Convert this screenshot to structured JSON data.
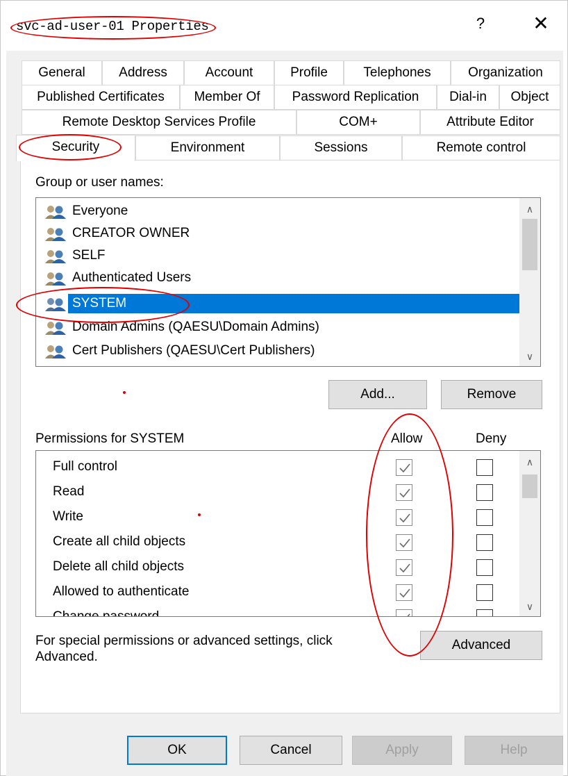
{
  "window": {
    "title": "svc-ad-user-01 Properties",
    "help_glyph": "?",
    "close_glyph": "✕"
  },
  "tabs": {
    "row1": [
      "General",
      "Address",
      "Account",
      "Profile",
      "Telephones",
      "Organization"
    ],
    "row2": [
      "Published Certificates",
      "Member Of",
      "Password Replication",
      "Dial-in",
      "Object"
    ],
    "row3": [
      "Remote Desktop Services Profile",
      "COM+",
      "Attribute Editor"
    ],
    "row4": [
      "Security",
      "Environment",
      "Sessions",
      "Remote control"
    ],
    "active": "Security"
  },
  "security": {
    "group_label": "Group or user names:",
    "users": [
      {
        "name": "Everyone",
        "icon": "users-group-icon",
        "selected": false
      },
      {
        "name": "CREATOR OWNER",
        "icon": "users-group-icon",
        "selected": false
      },
      {
        "name": "SELF",
        "icon": "users-group-icon",
        "selected": false
      },
      {
        "name": "Authenticated Users",
        "icon": "users-group-icon",
        "selected": false
      },
      {
        "name": "SYSTEM",
        "icon": "users-group-icon",
        "selected": true
      },
      {
        "name": "Domain Admins (QAESU\\Domain Admins)",
        "icon": "users-group-icon",
        "selected": false
      },
      {
        "name": "Cert Publishers (QAESU\\Cert Publishers)",
        "icon": "users-group-icon",
        "selected": false
      }
    ],
    "add_label": "Add...",
    "remove_label": "Remove",
    "permissions_label": "Permissions for SYSTEM",
    "allow_header": "Allow",
    "deny_header": "Deny",
    "permissions": [
      {
        "name": "Full control",
        "allow": true,
        "deny": false
      },
      {
        "name": "Read",
        "allow": true,
        "deny": false
      },
      {
        "name": "Write",
        "allow": true,
        "deny": false
      },
      {
        "name": "Create all child objects",
        "allow": true,
        "deny": false
      },
      {
        "name": "Delete all child objects",
        "allow": true,
        "deny": false
      },
      {
        "name": "Allowed to authenticate",
        "allow": true,
        "deny": false
      },
      {
        "name": "Change password",
        "allow": true,
        "deny": false
      }
    ],
    "advanced_text": "For special permissions or advanced settings, click Advanced.",
    "advanced_label": "Advanced"
  },
  "footer": {
    "ok_label": "OK",
    "cancel_label": "Cancel",
    "apply_label": "Apply",
    "help_label": "Help"
  },
  "colors": {
    "selection": "#0078d7",
    "annotation": "#e00000",
    "dialog_bg": "#f0f0f0"
  }
}
